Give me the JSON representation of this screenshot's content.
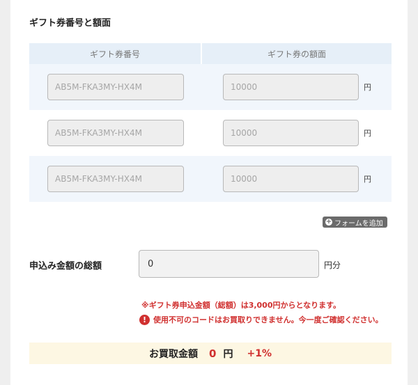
{
  "section_title": "ギフト券番号と額面",
  "table": {
    "headers": [
      "ギフト券番号",
      "ギフト券の額面"
    ],
    "rows": [
      {
        "code_placeholder": "AB5M-FKA3MY-HX4M",
        "amount_placeholder": "10000",
        "unit": "円"
      },
      {
        "code_placeholder": "AB5M-FKA3MY-HX4M",
        "amount_placeholder": "10000",
        "unit": "円"
      },
      {
        "code_placeholder": "AB5M-FKA3MY-HX4M",
        "amount_placeholder": "10000",
        "unit": "円"
      }
    ]
  },
  "add_form_button": {
    "label": "フォームを追加",
    "icon": "plus-circle-icon"
  },
  "total": {
    "label": "申込み金額の総額",
    "value": "0",
    "unit": "円分"
  },
  "notes": {
    "minimum": "※ギフト券申込金額（総額）は3,000円からとなります。",
    "warning": "使用不可のコードはお買取りできません。今一度ご確認ください。",
    "warning_icon": "exclamation-circle-icon"
  },
  "result": {
    "label": "お買取金額",
    "amount": "0",
    "unit": "円",
    "bonus": "+1%"
  },
  "colors": {
    "accent_red": "#d0302f",
    "header_bg": "#e6eff8",
    "alt_row_bg": "#f1f6fc",
    "result_bg": "#fdf7e3"
  }
}
